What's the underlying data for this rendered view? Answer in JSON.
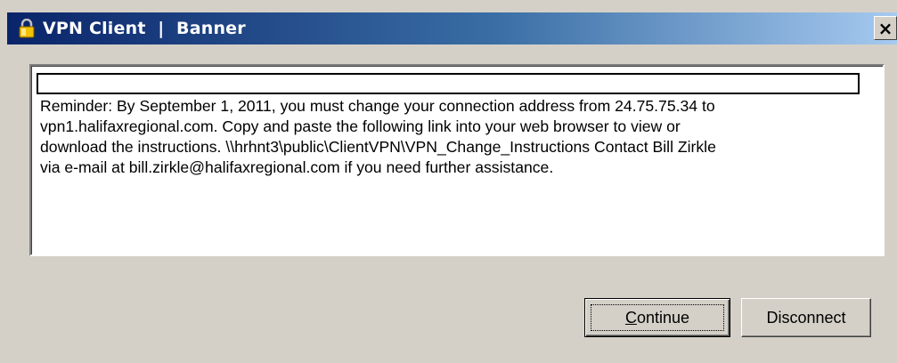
{
  "window": {
    "title": "VPN Client  |  Banner",
    "close_glyph": "×",
    "icon": "padlock-icon"
  },
  "banner": {
    "first_line": "",
    "message": "Reminder: By September 1, 2011, you must change your connection address from 24.75.75.34 to\nvpn1.halifaxregional.com. Copy and paste the following link into your web browser to view or\ndownload the instructions. \\\\hrhnt3\\public\\ClientVPN\\VPN_Change_Instructions Contact Bill Zirkle\nvia e-mail at bill.zirkle@halifaxregional.com if you need further assistance."
  },
  "buttons": {
    "continue_first": "C",
    "continue_rest": "ontinue",
    "disconnect": "Disconnect"
  },
  "colors": {
    "titlebar_start": "#0a246a",
    "titlebar_end": "#a6caf0",
    "face": "#d4d0c8"
  }
}
